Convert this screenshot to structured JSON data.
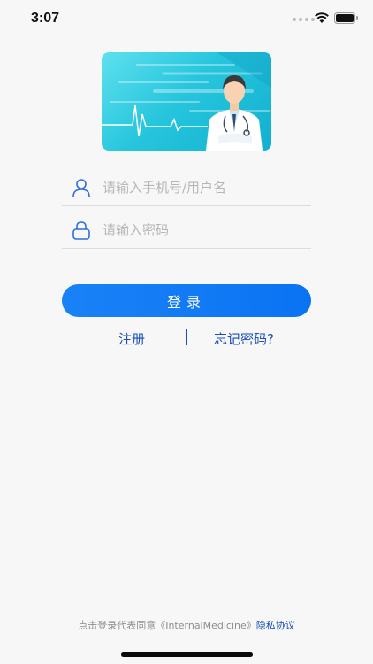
{
  "status_bar": {
    "time": "3:07",
    "icons": [
      "signal-dots-icon",
      "wifi-icon",
      "battery-icon"
    ]
  },
  "banner": {
    "icon": "doctor-heartbeat-illustration"
  },
  "form": {
    "username_placeholder": "请输入手机号/用户名",
    "password_placeholder": "请输入密码",
    "username_icon": "user-icon",
    "password_icon": "lock-icon"
  },
  "actions": {
    "login_label": "登录",
    "register_label": "注册",
    "forgot_label": "忘记密码?"
  },
  "agreement": {
    "prefix": "点击登录代表同意《InternalMedicine》",
    "privacy_link": "隐私协议"
  },
  "colors": {
    "accent": "#0a73f2",
    "link": "#1a4fb8",
    "banner": "#27c6dd"
  }
}
